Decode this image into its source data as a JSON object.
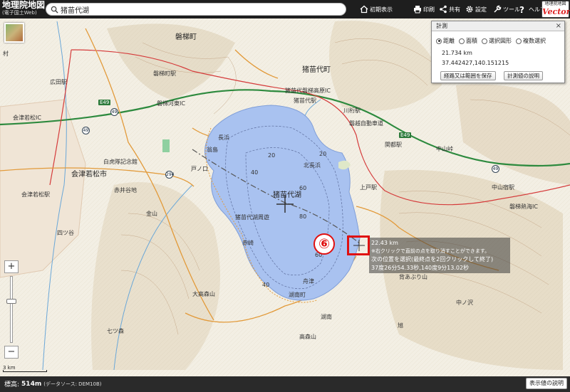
{
  "app": {
    "title": "地理院地図",
    "subtitle": "(電子国土Web)",
    "brand_top": "地理院地図",
    "brand_bottom": "Vector"
  },
  "search": {
    "value": "猪苗代湖",
    "placeholder": ""
  },
  "toolbar": {
    "items": [
      {
        "label": "初期表示",
        "icon": "home-icon"
      },
      {
        "label": "印刷",
        "icon": "print-icon"
      },
      {
        "label": "共有",
        "icon": "share-icon"
      },
      {
        "label": "設定",
        "icon": "gear-icon"
      },
      {
        "label": "ツール",
        "icon": "wrench-icon"
      },
      {
        "label": "ヘルプ",
        "icon": "help-icon"
      }
    ]
  },
  "measure": {
    "title": "計測",
    "close": "×",
    "modes": [
      {
        "label": "距離",
        "selected": true
      },
      {
        "label": "面積",
        "selected": false
      },
      {
        "label": "選択図形",
        "selected": false
      },
      {
        "label": "複数選択",
        "selected": false
      }
    ],
    "distance": "21.734 km",
    "coords": "37.442427,140.151215",
    "save_button": "経路又は範囲を保存",
    "help_button": "計測値の説明"
  },
  "tooltip": {
    "lines": [
      "22.43 km",
      "※右クリックで直前の点を取り消すことができます。",
      "次の位置を選択(最終点を2回クリックして終了)",
      "37度26分54.33秒,140度9分13.02秒"
    ]
  },
  "annotation": {
    "number": "⑥"
  },
  "zoom": {
    "in": "+",
    "out": "−"
  },
  "scale": {
    "label": "3 km"
  },
  "bottom": {
    "elevation_label": "標高:",
    "elevation_value": "514m",
    "source": "(データソース: DEM10B)",
    "button": "表示値の説明"
  },
  "map": {
    "lake_name": "猪苗代湖",
    "labels": [
      "磐梯町",
      "猪苗代町",
      "会津若松市",
      "長浜",
      "翁島",
      "北長浜",
      "湖南町",
      "磐越自動車道",
      "猪苗代磐梯高原IC",
      "会津若松IC",
      "磐梯河東IC",
      "猪苗代駅",
      "会津若松駅",
      "広田駅",
      "磐梯町駅",
      "川桁駅",
      "関都駅",
      "上戸駅",
      "中山宿駅",
      "白虎隊記念館",
      "背あぶり山",
      "大高森山",
      "高森山",
      "赤井谷地",
      "戸ノ口",
      "中山峠",
      "七ツ森",
      "金山",
      "赤崎",
      "舟津",
      "湖南",
      "中ノ沢",
      "磐梯熱海IC",
      "村",
      "旭",
      "四ツ谷",
      "猪苗代湖周遊"
    ],
    "depth_labels": [
      "20",
      "40",
      "60",
      "80",
      "60",
      "40",
      "20"
    ],
    "route_numbers": [
      "49",
      "49",
      "294",
      "49",
      "E49",
      "E49"
    ]
  }
}
